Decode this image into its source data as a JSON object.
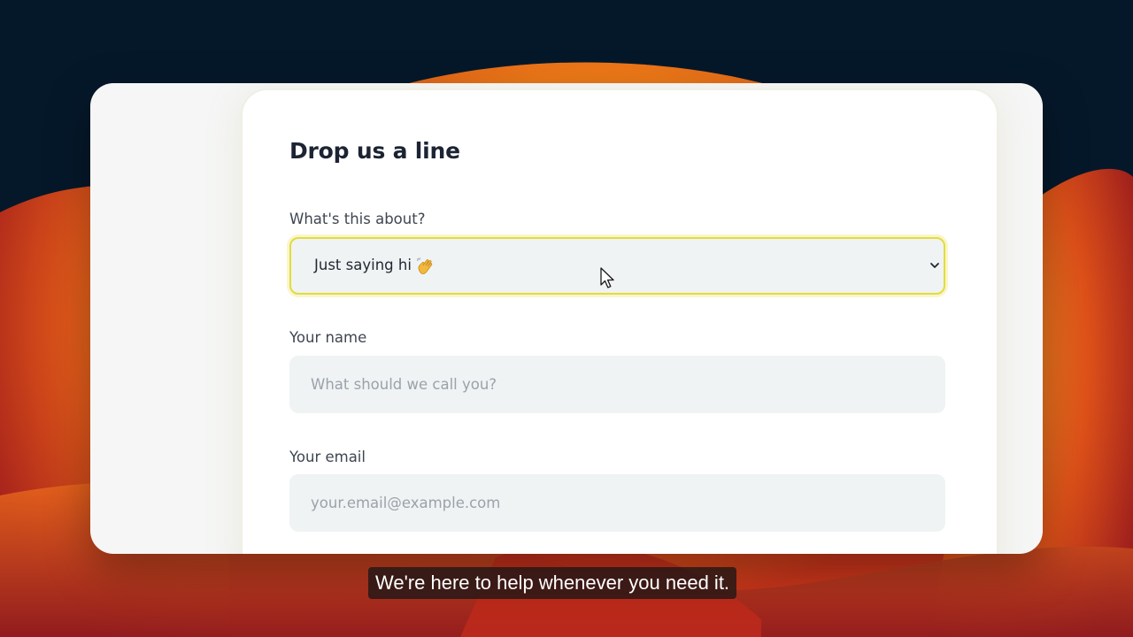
{
  "form": {
    "title": "Drop us a line",
    "topic_label": "What's this about?",
    "topic_selected": "Just saying hi",
    "topic_emoji_icon": "waving-hand-icon",
    "name_label": "Your name",
    "name_placeholder": "What should we call you?",
    "email_label": "Your email",
    "email_placeholder": "your.email@example.com"
  },
  "caption": {
    "text": "We're here to help whenever you need it."
  },
  "colors": {
    "focus_border": "#e3dc3c",
    "field_background": "#f0f3f3",
    "title_text": "#1c2433",
    "wallpaper_orange": "#f47a1c",
    "wallpaper_navy": "#05182a"
  }
}
